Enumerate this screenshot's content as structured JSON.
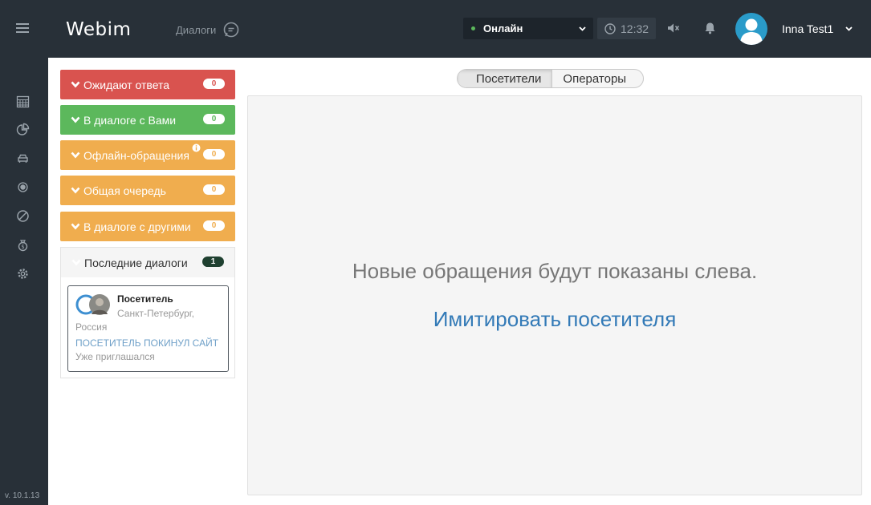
{
  "header": {
    "logo_text": "Webim",
    "dialogs_label": "Диалоги",
    "status_label": "Онлайн",
    "clock_time": "12:32",
    "user_name": "Inna Test1"
  },
  "sidebar": {
    "icons": [
      "calendar-icon",
      "pie-chart-icon",
      "visitors-icon",
      "record-icon",
      "ban-icon",
      "money-bag-icon",
      "gear-icon"
    ],
    "version": "v. 10.1.13"
  },
  "queues": [
    {
      "label": "Ожидают ответа",
      "count": "0",
      "color": "#d9534f"
    },
    {
      "label": "В диалоге с Вами",
      "count": "0",
      "color": "#5cb85c"
    },
    {
      "label": "Офлайн-обращения",
      "count": "0",
      "color": "#f0ad4e"
    },
    {
      "label": "Общая очередь",
      "count": "0",
      "color": "#f0ad4e"
    },
    {
      "label": "В диалоге с другими",
      "count": "0",
      "color": "#f0ad4e"
    }
  ],
  "recent": {
    "title": "Последние диалоги",
    "count": "1",
    "visitor": {
      "name": "Посетитель",
      "city": "Санкт-Петербург,",
      "country": "Россия",
      "status": "ПОСЕТИТЕЛЬ ПОКИНУЛ САЙТ",
      "note": "Уже приглашался"
    }
  },
  "tabs": {
    "visitors": "Посетители",
    "operators": "Операторы"
  },
  "main": {
    "message": "Новые обращения будут показаны слева.",
    "simulate_link": "Имитировать посетителя"
  }
}
